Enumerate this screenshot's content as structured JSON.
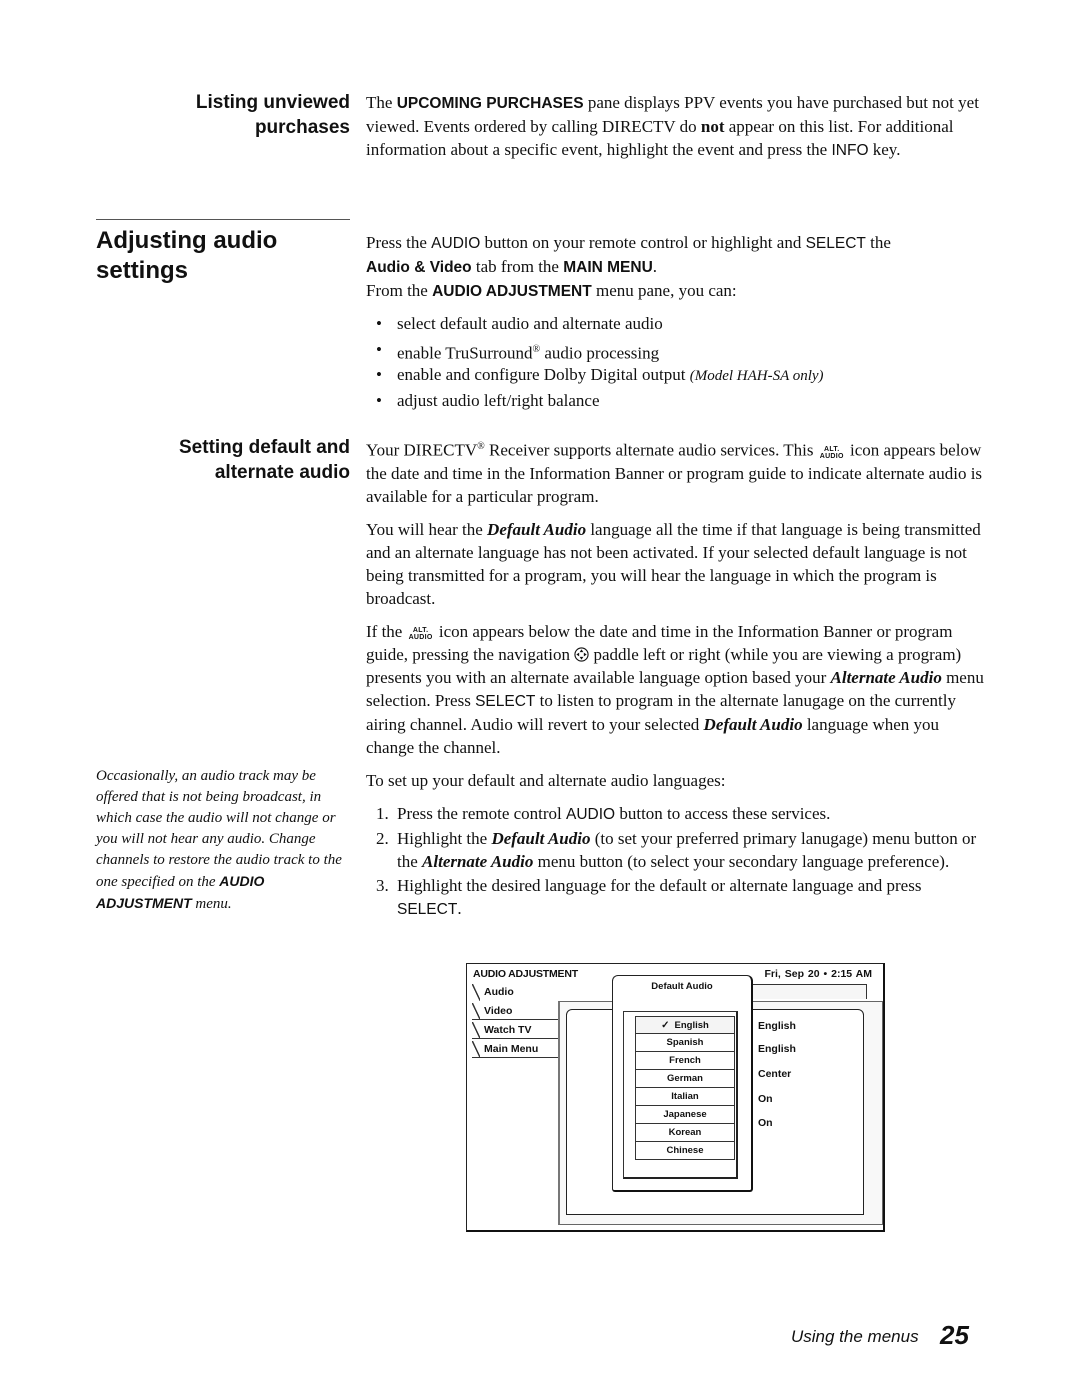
{
  "sections": {
    "listing": {
      "heading_line1": "Listing unviewed",
      "heading_line2": "purchases",
      "text_1": "The ",
      "text_upcoming": "UPCOMING PURCHASES",
      "text_2": " pane displays PPV events you have purchased but not yet viewed. Events ordered by calling DIRECTV do ",
      "text_not": "not",
      "text_3": " appear on this list. For additional information about a specific event, highlight the event and press the ",
      "text_info": "INFO",
      "text_4": " key."
    },
    "adjusting": {
      "heading_line1": "Adjusting audio",
      "heading_line2": "settings",
      "p1_a": "Press the ",
      "p1_audio": "AUDIO",
      "p1_b": " button on your remote control or highlight and ",
      "p1_select": "SELECT",
      "p1_c": " the",
      "p1_av": "Audio & Video",
      "p1_d": " tab from the ",
      "p1_mainmenu": "MAIN MENU",
      "p1_e": ".",
      "p2_a": "From the ",
      "p2_menu": "AUDIO ADJUSTMENT",
      "p2_b": " menu pane, you can:",
      "bullets": [
        "select default audio and alternate audio",
        "enable TruSurround",
        "enable and configure Dolby Digital output ",
        "adjust audio left/right balance"
      ],
      "bullet2_reg": "®",
      "bullet2_tail": " audio processing",
      "bullet3_note": "(Model HAH-SA only)"
    },
    "setting_default": {
      "heading_line1": "Setting default and",
      "heading_line2": "alternate audio",
      "p1_a": "Your DIRECTV",
      "p1_reg": "®",
      "p1_b": " Receiver supports alternate audio services. This ",
      "p1_c": " icon appears below the date and time in the Information Banner or program guide to indicate alternate audio is available for a particular program.",
      "p2_a": "You will hear the ",
      "p2_default": "Default Audio",
      "p2_b": " language all the time if that language is being transmitted and an alternate language has not been activated. If your selected default language is not being transmitted for a program, you will hear the language in which the program is broadcast.",
      "p3_a": "If the ",
      "p3_b": " icon appears below the date and time in the Information Banner or program guide, pressing the navigation ",
      "p3_c": " paddle left or right (while you are viewing a program) presents you with an alternate available language option based your ",
      "p3_alt": "Alternate Audio",
      "p3_d": " menu selection. Press ",
      "p3_select": "SELECT",
      "p3_e": " to listen to program in the alternate lanugage on the currently airing channel. Audio will revert to your selected ",
      "p3_default": "Default Audio",
      "p3_f": " language when you change the channel.",
      "p4": "To set up your default and alternate audio languages:",
      "steps": [
        {
          "num": "1.",
          "a": "Press the remote control ",
          "k": "AUDIO",
          "b": " button to access these services."
        },
        {
          "num": "2.",
          "a": "Highlight the ",
          "bi1": "Default Audio",
          "b": " (to set your preferred primary lanugage) menu button or the ",
          "bi2": "Alternate Audio",
          "c": " menu button (to select your secondary language preference)."
        },
        {
          "num": "3.",
          "a": "Highlight the desired language for the default or alternate language and press ",
          "k": "SELECT",
          "b": "."
        }
      ]
    }
  },
  "alt_audio_icon": {
    "line1": "ALT.",
    "line2": "AUDIO",
    "icon": "alt-audio-icon"
  },
  "nav_icon": "navigation-paddle-icon",
  "sidenote": {
    "text": "Occasionally, an audio track may be offered that is not being broadcast, in which case the audio will not change or you will not hear any audio. Change channels to restore the audio track to the one specified on the ",
    "bold": "AUDIO ADJUSTMENT",
    "tail": " menu."
  },
  "menu_figure": {
    "title": "AUDIO ADJUSTMENT",
    "datetime": "Fri, Sep 20 •  2:15 AM",
    "tabs": [
      "Audio",
      "Video",
      "Watch TV",
      "Main Menu"
    ],
    "active_tab": "Audio",
    "popup_title": "Default Audio",
    "check_mark": "✓",
    "languages": [
      "English",
      "Spanish",
      "French",
      "German",
      "Italian",
      "Japanese",
      "Korean",
      "Chinese"
    ],
    "selected_language": "English",
    "values": [
      "English",
      "English",
      "Center",
      "On",
      "On"
    ]
  },
  "footer": {
    "section": "Using the menus",
    "page": "25"
  }
}
